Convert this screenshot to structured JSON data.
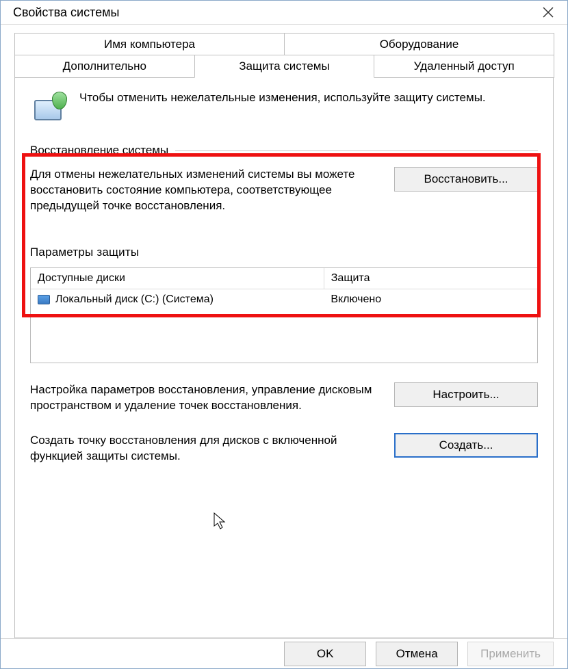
{
  "title": "Свойства системы",
  "tabs_row1": [
    {
      "label": "Имя компьютера"
    },
    {
      "label": "Оборудование"
    }
  ],
  "tabs_row2": [
    {
      "label": "Дополнительно"
    },
    {
      "label": "Защита системы",
      "active": true
    },
    {
      "label": "Удаленный доступ"
    }
  ],
  "intro_text": "Чтобы отменить нежелательные изменения, используйте защиту системы.",
  "restore_section": {
    "legend": "Восстановление системы",
    "text": "Для отмены нежелательных изменений системы вы можете восстановить состояние компьютера, соответствующее предыдущей точке восстановления.",
    "button": "Восстановить..."
  },
  "protection_section": {
    "legend_truncated": "Параметры защиты",
    "col_drive": "Доступные диски",
    "col_protection": "Защита",
    "drive_name": "Локальный диск (C:) (Система)",
    "drive_status": "Включено",
    "configure_text": "Настройка параметров восстановления, управление дисковым пространством и удаление точек восстановления.",
    "configure_button": "Настроить...",
    "create_text": "Создать точку восстановления для дисков с включенной функцией защиты системы.",
    "create_button": "Создать..."
  },
  "buttons": {
    "ok": "OK",
    "cancel": "Отмена",
    "apply": "Применить"
  }
}
